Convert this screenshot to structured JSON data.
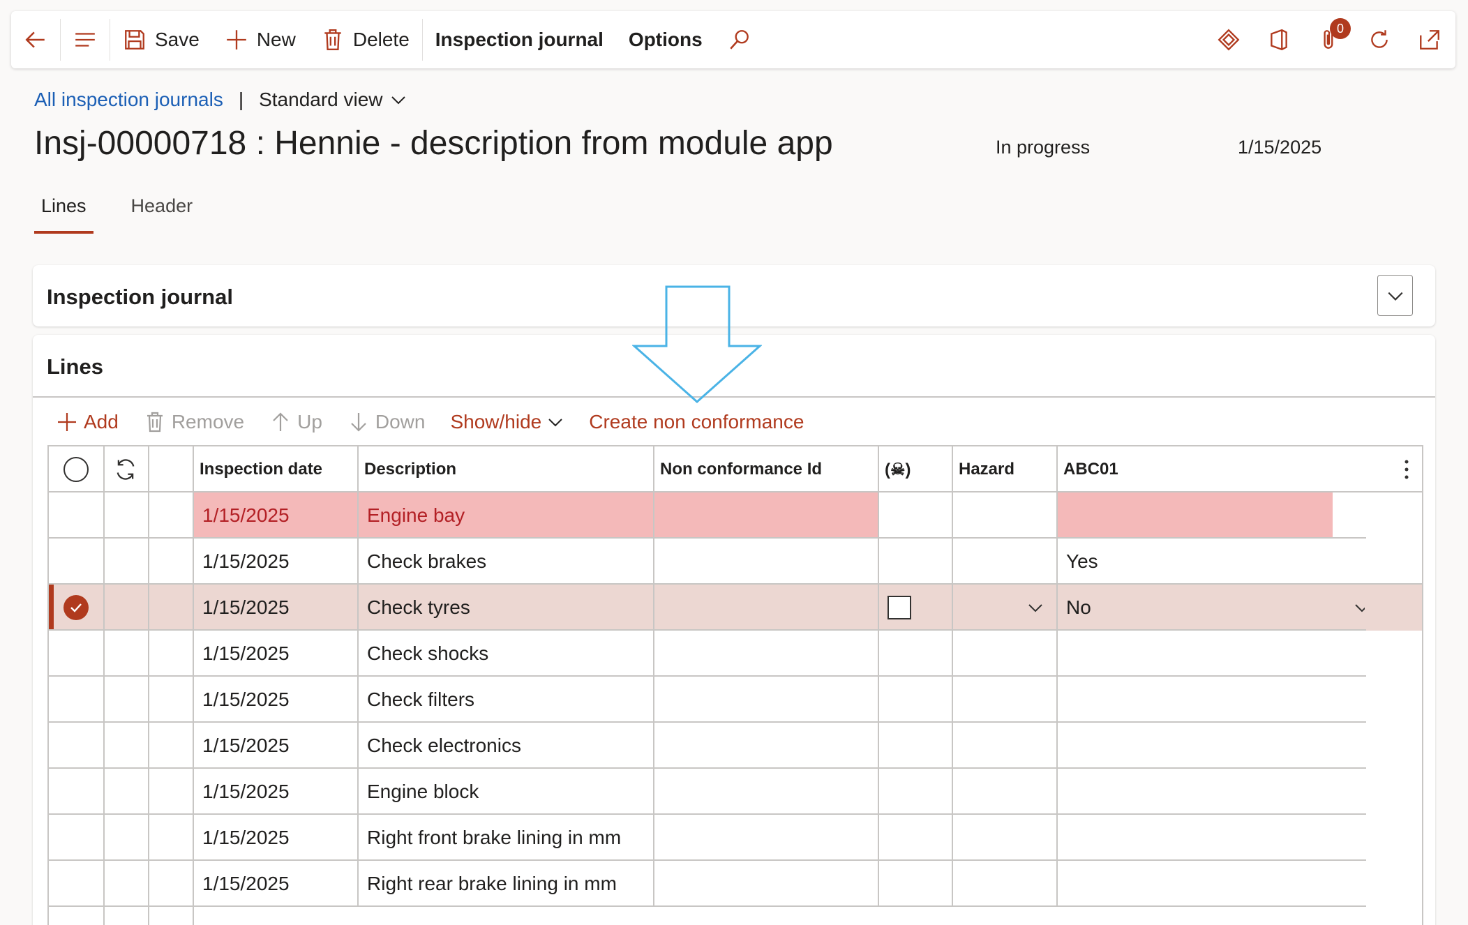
{
  "toolbar": {
    "save_label": "Save",
    "new_label": "New",
    "delete_label": "Delete",
    "journal_label": "Inspection journal",
    "options_label": "Options",
    "attachments_count": "0"
  },
  "breadcrumb": {
    "link": "All inspection journals",
    "separator": "|",
    "view": "Standard view"
  },
  "header": {
    "title": "Insj-00000718 : Hennie - description from module app",
    "status": "In progress",
    "date": "1/15/2025"
  },
  "tabs": [
    {
      "label": "Lines",
      "active": true
    },
    {
      "label": "Header",
      "active": false
    }
  ],
  "sections": {
    "journal_title": "Inspection journal",
    "lines_title": "Lines"
  },
  "line_actions": {
    "add": "Add",
    "remove": "Remove",
    "up": "Up",
    "down": "Down",
    "show_hide": "Show/hide",
    "create_nc": "Create non conformance"
  },
  "grid": {
    "columns": [
      "Inspection date",
      "Description",
      "Non conformance Id",
      "(☠)",
      "Hazard",
      "ABC01"
    ],
    "rows": [
      {
        "date": "1/15/2025",
        "description": "Engine bay",
        "nc_id": "",
        "abc01": "",
        "error": true
      },
      {
        "date": "1/15/2025",
        "description": "Check brakes",
        "nc_id": "",
        "abc01": "Yes"
      },
      {
        "date": "1/15/2025",
        "description": "Check tyres",
        "nc_id": "",
        "abc01": "No",
        "selected": true
      },
      {
        "date": "1/15/2025",
        "description": "Check shocks",
        "nc_id": "",
        "abc01": ""
      },
      {
        "date": "1/15/2025",
        "description": "Check filters",
        "nc_id": "",
        "abc01": ""
      },
      {
        "date": "1/15/2025",
        "description": "Check electronics",
        "nc_id": "",
        "abc01": ""
      },
      {
        "date": "1/15/2025",
        "description": "Engine block",
        "nc_id": "",
        "abc01": ""
      },
      {
        "date": "1/15/2025",
        "description": "Right front brake lining in mm",
        "nc_id": "",
        "abc01": ""
      },
      {
        "date": "1/15/2025",
        "description": "Right rear brake lining in mm",
        "nc_id": "",
        "abc01": ""
      }
    ]
  },
  "colors": {
    "accent": "#b03a1e",
    "error_bg": "#f4b9b9",
    "selected_bg": "#ecd7d2",
    "link": "#1b5fb5",
    "annotation_arrow": "#4ab3e6"
  }
}
